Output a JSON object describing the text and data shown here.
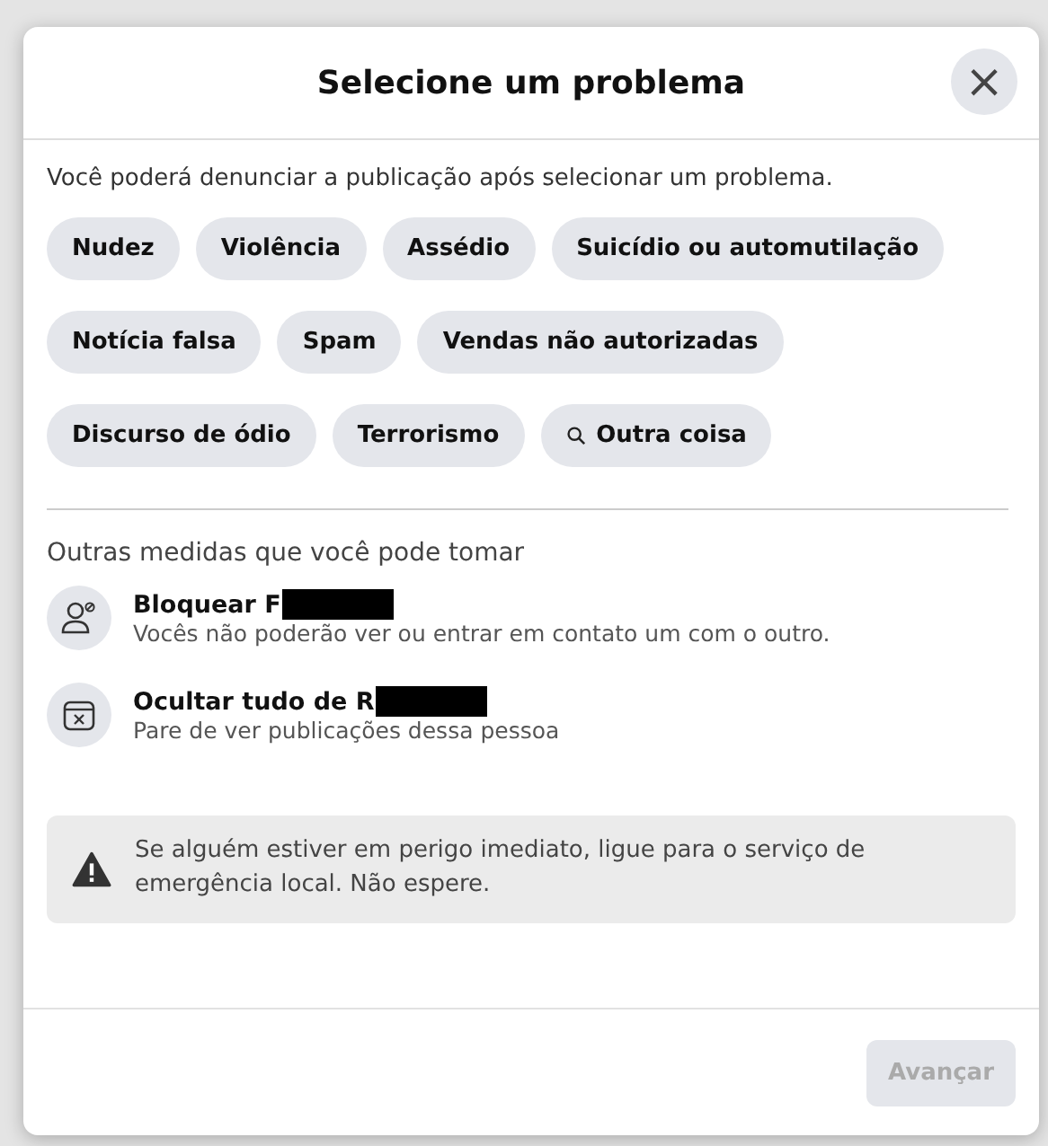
{
  "dialog": {
    "title": "Selecione um problema",
    "close": "×"
  },
  "intro": "Você poderá denunciar a publicação após selecionar um problema.",
  "problems": [
    {
      "label": "Nudez",
      "kind": "plain"
    },
    {
      "label": "Violência",
      "kind": "plain"
    },
    {
      "label": "Assédio",
      "kind": "plain"
    },
    {
      "label": "Suicídio ou automutilação",
      "kind": "plain"
    },
    {
      "label": "Notícia falsa",
      "kind": "plain"
    },
    {
      "label": "Spam",
      "kind": "plain"
    },
    {
      "label": "Vendas não autorizadas",
      "kind": "plain"
    },
    {
      "label": "Discurso de ódio",
      "kind": "plain"
    },
    {
      "label": "Terrorismo",
      "kind": "plain"
    },
    {
      "label": "Outra coisa",
      "kind": "search"
    }
  ],
  "other_actions": {
    "heading": "Outras medidas que você pode tomar",
    "items": [
      {
        "title": "Bloquear F",
        "description": "Vocês não poderão ver ou entrar em contato um com o outro.",
        "kind": "block",
        "redacted": true
      },
      {
        "title": "Ocultar tudo de R",
        "description": "Pare de ver publicações dessa pessoa",
        "kind": "hide",
        "redacted": true
      }
    ]
  },
  "warning": "Se alguém estiver em perigo imediato, ligue para o serviço de emergência local. Não espere.",
  "footer": {
    "button": {
      "label": "Avançar",
      "disabled": true
    }
  }
}
